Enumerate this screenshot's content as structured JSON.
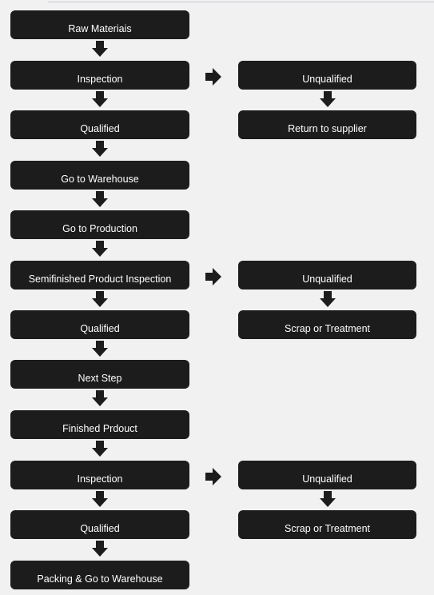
{
  "colors": {
    "box": "#1c1c1c",
    "text": "#ffffff",
    "arrow": "#1c1c1c",
    "background": "#f1f1f1"
  },
  "main_flow": [
    "Raw Materiais",
    "Inspection",
    "Qualified",
    "Go to Warehouse",
    "Go to Production",
    "Semifinished Product Inspection",
    "Qualified",
    "Next Step",
    "Finished Prdouct",
    "Inspection",
    "Qualified",
    "Packing & Go to Warehouse"
  ],
  "branches": [
    {
      "from_step": 2,
      "unqualified": "Unqualified",
      "outcome": "Return to supplier"
    },
    {
      "from_step": 6,
      "unqualified": "Unqualified",
      "outcome": "Scrap or Treatment"
    },
    {
      "from_step": 10,
      "unqualified": "Unqualified",
      "outcome": "Scrap or Treatment"
    }
  ]
}
